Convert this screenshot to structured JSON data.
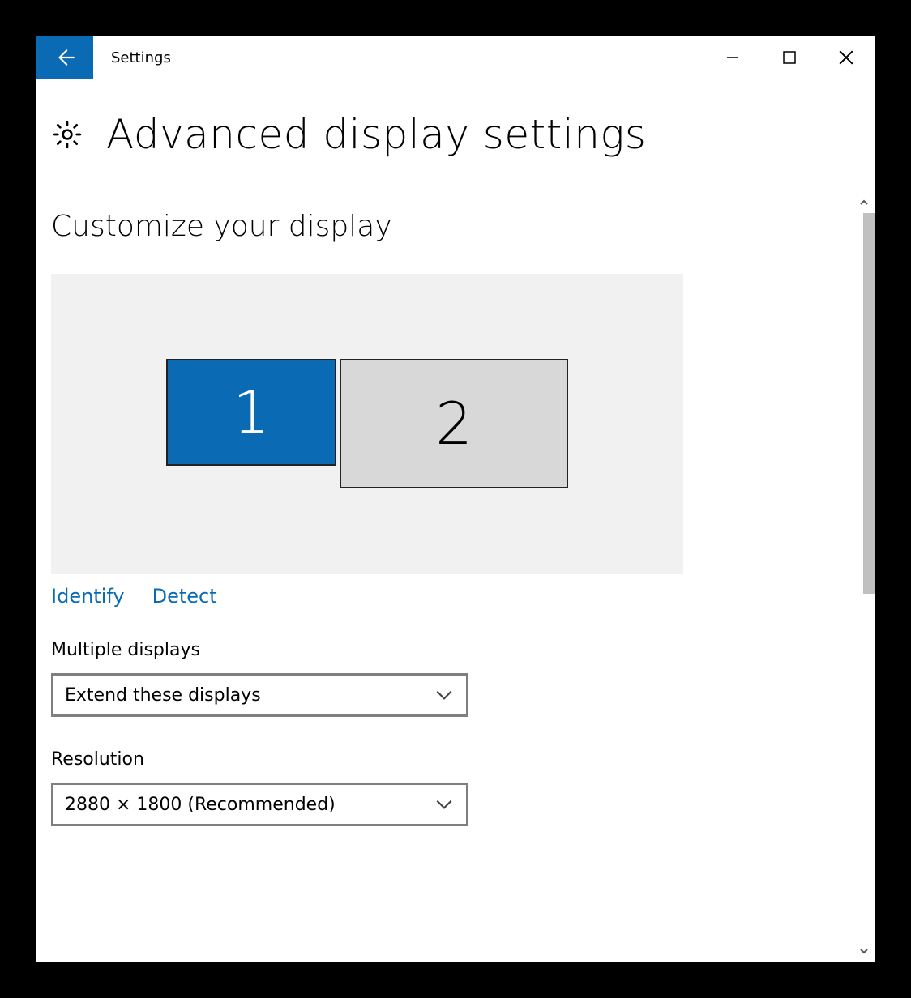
{
  "window": {
    "title": "Settings"
  },
  "header": {
    "title": "Advanced display settings"
  },
  "section": {
    "customize": "Customize your display"
  },
  "monitors": {
    "one": "1",
    "two": "2"
  },
  "links": {
    "identify": "Identify",
    "detect": "Detect"
  },
  "multi": {
    "label": "Multiple displays",
    "value": "Extend these displays"
  },
  "resolution": {
    "label": "Resolution",
    "value": "2880 × 1800 (Recommended)"
  }
}
